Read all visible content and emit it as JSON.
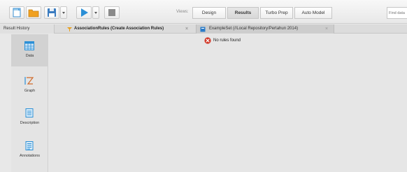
{
  "toolbar": {
    "buttons": [
      {
        "name": "new-process-button",
        "icon": "new-document-icon"
      },
      {
        "name": "open-process-button",
        "icon": "folder-icon"
      },
      {
        "name": "save-process-button",
        "icon": "floppy-disk-icon"
      },
      {
        "name": "run-process-button",
        "icon": "play-icon"
      },
      {
        "name": "stop-process-button",
        "icon": "stop-icon"
      }
    ],
    "views_label": "Views:",
    "views": [
      {
        "label": "Design",
        "active": false
      },
      {
        "label": "Results",
        "active": true
      },
      {
        "label": "Turbo Prep",
        "active": false
      },
      {
        "label": "Auto Model",
        "active": false
      }
    ],
    "find_placeholder": "Find data"
  },
  "tabs": {
    "result_history": "Result History",
    "association_rules": "AssociationRules (Create Association Rules)",
    "example_set": "ExampleSet (//Local Repository/Pertahun 2014)",
    "close_glyph": "×"
  },
  "sidebar": {
    "items": [
      {
        "label": "Data",
        "icon": "table-icon",
        "active": true
      },
      {
        "label": "Graph",
        "icon": "graph-icon",
        "active": false
      },
      {
        "label": "Description",
        "icon": "description-icon",
        "active": false
      },
      {
        "label": "Annotations",
        "icon": "annotations-icon",
        "active": false
      }
    ]
  },
  "main": {
    "message": "No rules found",
    "message_icon": "error-icon"
  },
  "colors": {
    "accent_blue": "#2b8fd6",
    "folder_orange": "#f0a020",
    "error_red": "#d23a2a"
  }
}
